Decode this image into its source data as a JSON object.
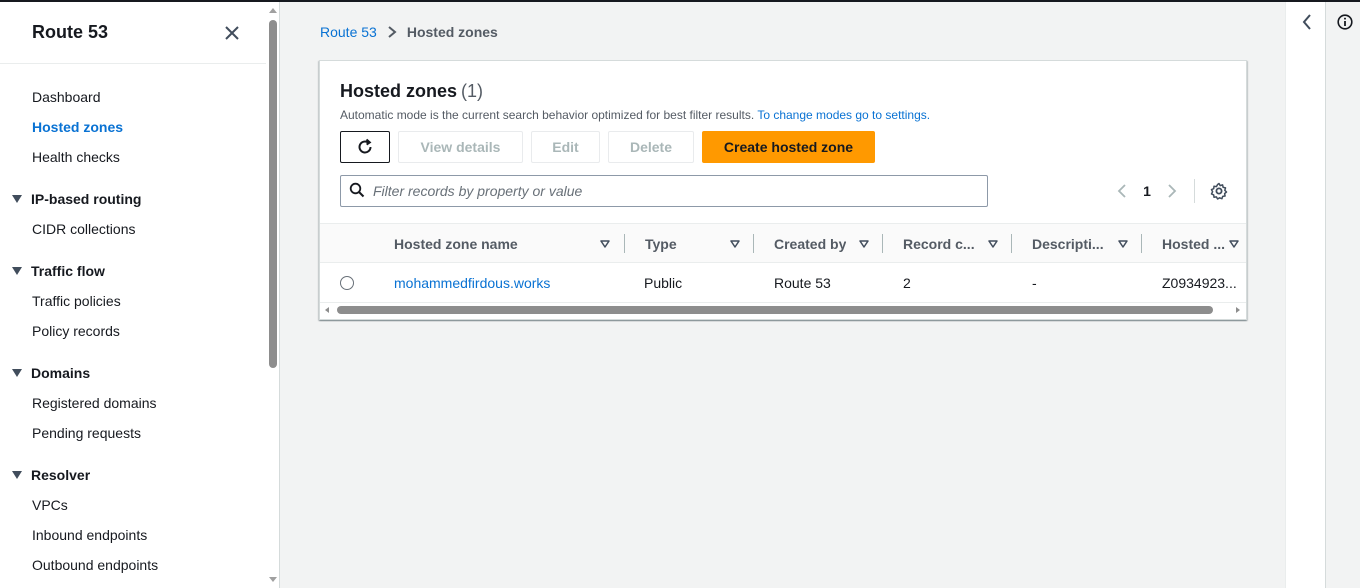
{
  "sidebar": {
    "title": "Route 53",
    "top_items": [
      {
        "label": "Dashboard",
        "active": false
      },
      {
        "label": "Hosted zones",
        "active": true
      },
      {
        "label": "Health checks",
        "active": false
      }
    ],
    "sections": [
      {
        "title": "IP-based routing",
        "items": [
          "CIDR collections"
        ]
      },
      {
        "title": "Traffic flow",
        "items": [
          "Traffic policies",
          "Policy records"
        ]
      },
      {
        "title": "Domains",
        "items": [
          "Registered domains",
          "Pending requests"
        ]
      },
      {
        "title": "Resolver",
        "items": [
          "VPCs",
          "Inbound endpoints",
          "Outbound endpoints"
        ]
      }
    ]
  },
  "breadcrumb": {
    "root": "Route 53",
    "current": "Hosted zones"
  },
  "panel": {
    "title": "Hosted zones",
    "count": "(1)",
    "description": "Automatic mode is the current search behavior optimized for best filter results.",
    "description_link": "To change modes go to settings.",
    "actions": {
      "view_details": "View details",
      "edit": "Edit",
      "delete": "Delete",
      "create": "Create hosted zone"
    },
    "search_placeholder": "Filter records by property or value",
    "page": "1"
  },
  "table": {
    "columns": [
      "Hosted zone name",
      "Type",
      "Created by",
      "Record c...",
      "Descripti...",
      "Hosted ..."
    ],
    "rows": [
      {
        "name": "mohammedfirdous.works",
        "type": "Public",
        "created_by": "Route 53",
        "record_count": "2",
        "description": "-",
        "hosted_zone_id": "Z0934923..."
      }
    ]
  },
  "colors": {
    "accent_link": "#0972d3",
    "primary_button": "#ff9900",
    "text": "#16191f"
  },
  "icons": {
    "refresh": "refresh-icon",
    "search": "search-icon",
    "settings": "gear-icon",
    "close": "close-icon",
    "info": "info-icon"
  }
}
